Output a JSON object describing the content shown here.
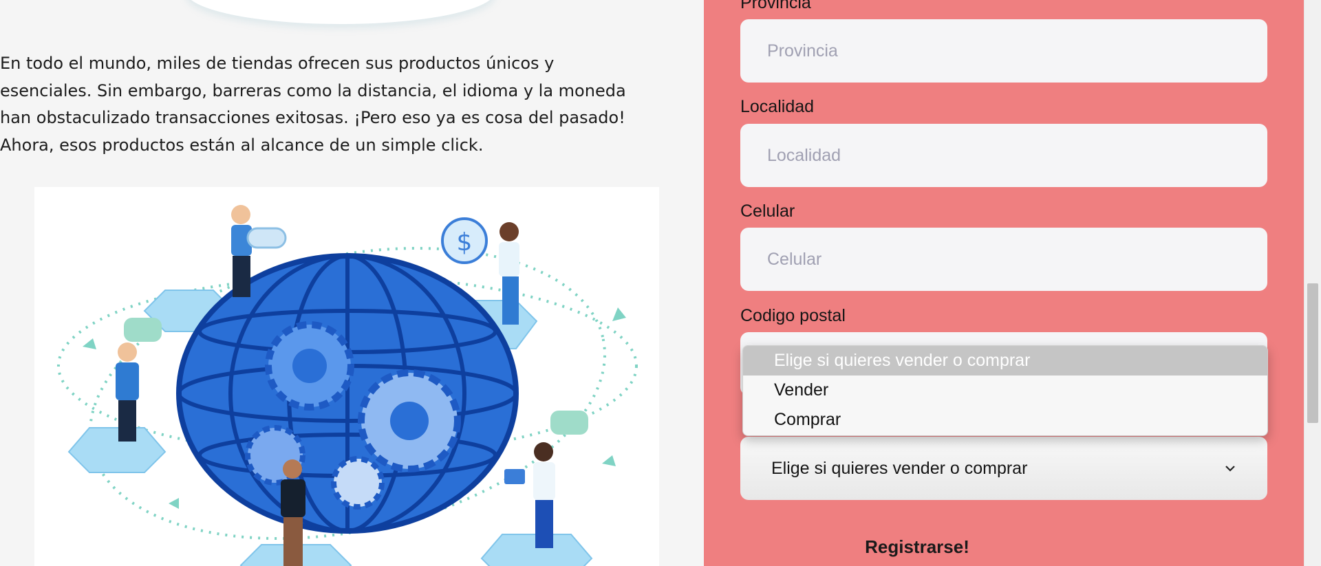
{
  "intro": {
    "paragraph": "En todo el mundo, miles de tiendas ofrecen sus productos únicos y esenciales. Sin embargo, barreras como la distancia, el idioma y la moneda han obstaculizado transacciones exitosas. ¡Pero eso ya es cosa del pasado! Ahora, esos productos están al alcance de un simple click."
  },
  "form": {
    "provincia": {
      "label": "Provincia",
      "placeholder": "Provincia"
    },
    "localidad": {
      "label": "Localidad",
      "placeholder": "Localidad"
    },
    "celular": {
      "label": "Celular",
      "placeholder": "Celular"
    },
    "codigo_postal": {
      "label": "Codigo postal"
    },
    "role_select": {
      "selected": "Elige si quieres vender o comprar",
      "options": [
        "Elige si quieres vender o comprar",
        "Vender",
        "Comprar"
      ]
    },
    "submit_label": "Registrarse!"
  },
  "colors": {
    "form_background": "#ef7f80",
    "page_background": "#f5f5f5",
    "input_background": "#f5f5f7",
    "globe_blue": "#1f5fc9"
  },
  "icons": {
    "select_arrow": "chevron-down-icon",
    "illustration": "global-commerce-illustration"
  }
}
